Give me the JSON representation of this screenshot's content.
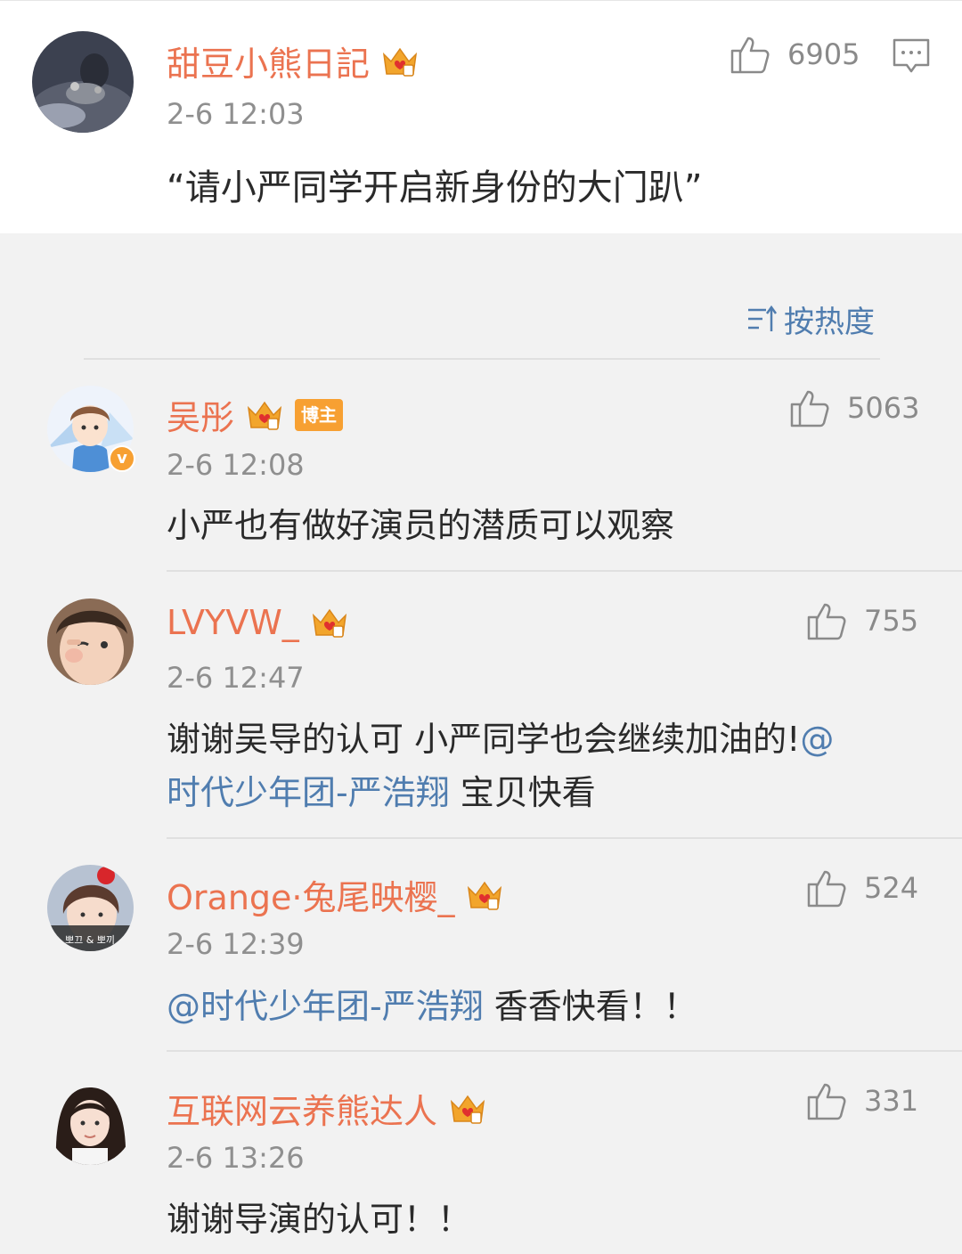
{
  "top_comment": {
    "username": "甜豆小熊日記",
    "time": "2-6 12:03",
    "likes": "6905",
    "content": "“请小严同学开启新身份的大门趴”"
  },
  "sort": {
    "label": "按热度",
    "icon": "sort-icon"
  },
  "replies": [
    {
      "username": "吴彤",
      "badge": "博主",
      "verified_mark": "v",
      "time": "2-6 12:08",
      "likes": "5063",
      "content": "小严也有做好演员的潜质可以观察"
    },
    {
      "username": "LVYVW_",
      "time": "2-6 12:47",
      "likes": "755",
      "content_line1_text": "谢谢吴导的认可 小严同学也会继续加油的!",
      "content_line1_mention": "@",
      "content_line2_mention": "时代少年团-严浩翔",
      "content_line2_text": " 宝贝快看"
    },
    {
      "username": "Orange·兔尾映樱_",
      "time": "2-6 12:39",
      "likes": "524",
      "content_mention": "@时代少年团-严浩翔",
      "content_text": " 香香快看！！",
      "avatar_caption": "뽀끄 & 뽀끼"
    },
    {
      "username": "互联网云养熊达人",
      "time": "2-6 13:26",
      "likes": "331",
      "content": "谢谢导演的认可！！"
    }
  ],
  "colors": {
    "username": "#eb7350",
    "mention": "#507daf",
    "badge": "#f7a032",
    "crown": "#f2a52c",
    "time": "#8f8f8f"
  }
}
